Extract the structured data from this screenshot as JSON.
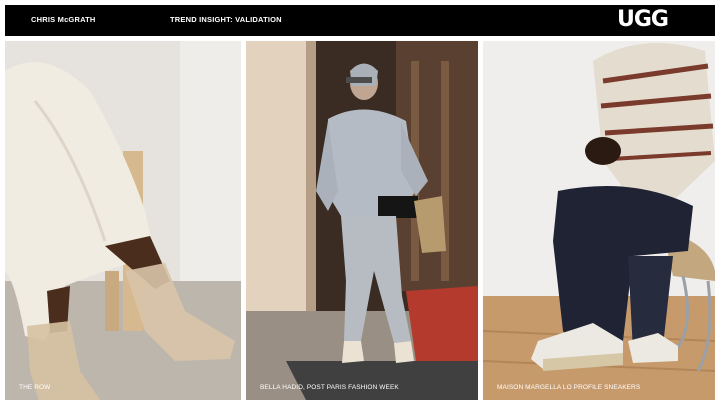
{
  "header": {
    "author": "CHRIS McGRATH",
    "title": "TREND INSIGHT: VALIDATION",
    "logo": "UGG"
  },
  "panels": [
    {
      "caption": "THE ROW"
    },
    {
      "caption": "BELLA HADID, POST PARIS FASHION WEEK"
    },
    {
      "caption": "MAISON MARGELLA LO PROFILE SNEAKERS"
    }
  ]
}
